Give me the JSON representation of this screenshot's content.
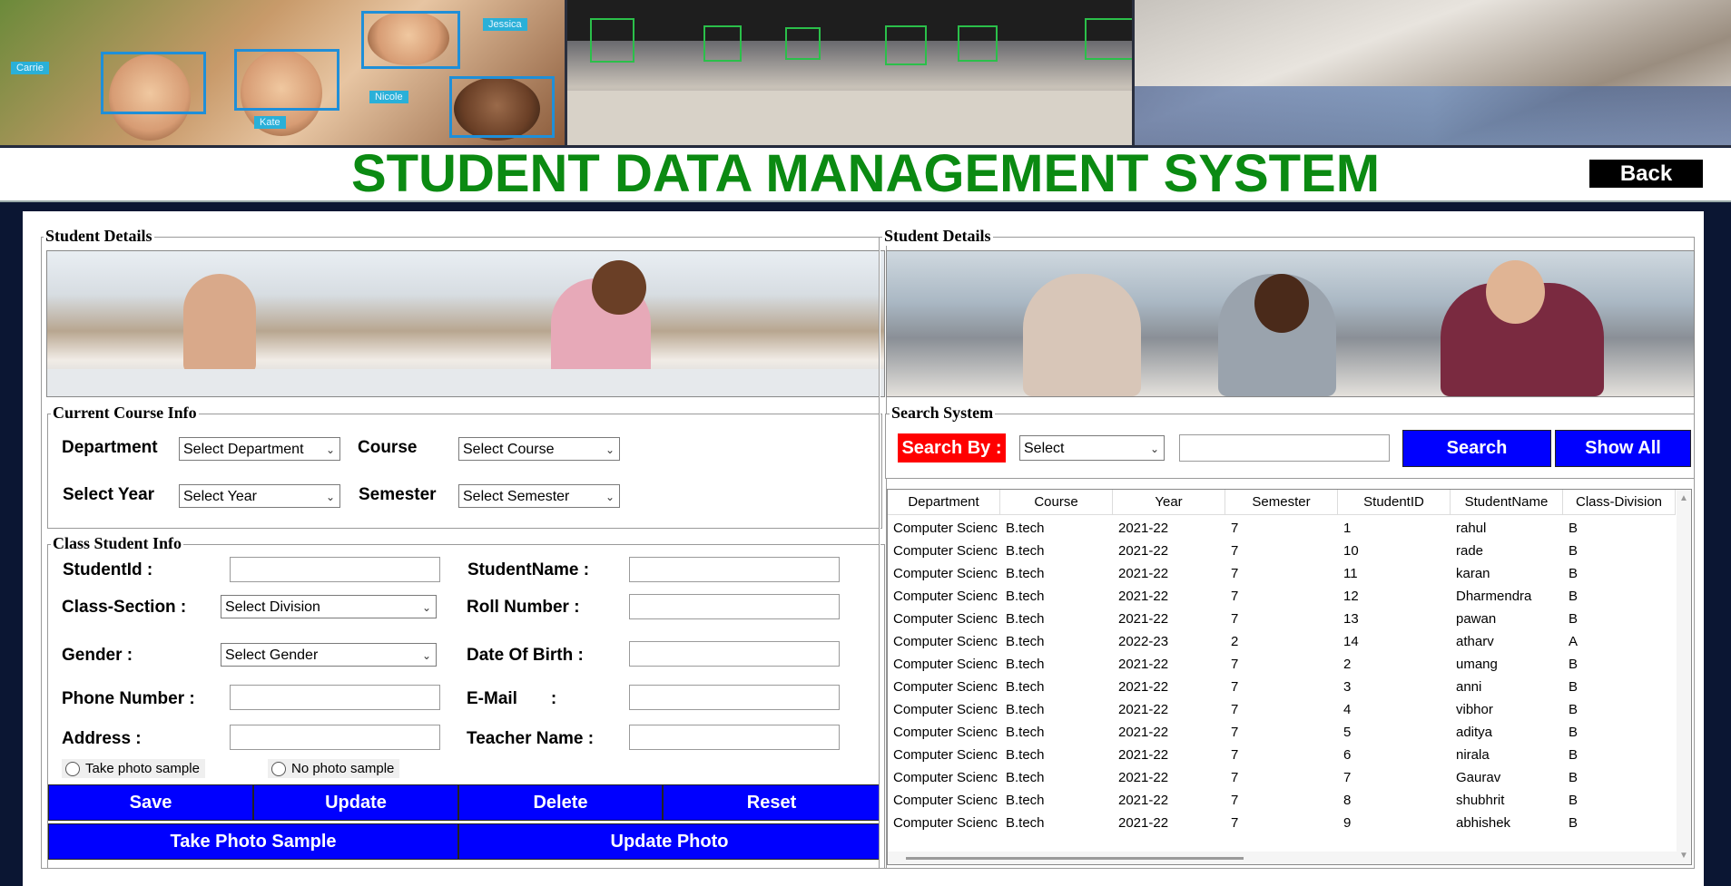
{
  "banner": {
    "name_tags": [
      "Carrie",
      "Kate",
      "Jessica",
      "Nicole"
    ]
  },
  "title": "STUDENT DATA MANAGEMENT SYSTEM",
  "back_label": "Back",
  "left_panel": {
    "legend": "Student Details",
    "course_info": {
      "legend": "Current Course Info",
      "department_label": "Department",
      "department_value": "Select Department",
      "course_label": "Course",
      "course_value": "Select Course",
      "year_label": "Select Year",
      "year_value": "Select Year",
      "semester_label": "Semester",
      "semester_value": "Select Semester"
    },
    "student_info": {
      "legend": "Class Student Info",
      "student_id_label": "StudentId :",
      "student_name_label": "StudentName :",
      "class_section_label": "Class-Section :",
      "class_section_value": "Select Division",
      "roll_number_label": "Roll Number :",
      "gender_label": "Gender :",
      "gender_value": "Select Gender",
      "dob_label": "Date Of Birth :",
      "phone_label": "Phone Number :",
      "email_label": "E-Mail       :",
      "address_label": "Address :",
      "teacher_label": "Teacher Name :",
      "radio_take": "Take photo sample",
      "radio_no": "No photo sample"
    },
    "buttons": {
      "save": "Save",
      "update": "Update",
      "delete": "Delete",
      "reset": "Reset",
      "take_photo": "Take Photo Sample",
      "update_photo": "Update Photo"
    }
  },
  "right_panel": {
    "legend": "Student Details",
    "search": {
      "legend": "Search System",
      "search_by_label": "Search By :",
      "search_by_value": "Select",
      "search_button": "Search",
      "show_all_button": "Show All"
    },
    "table": {
      "columns": [
        "Department",
        "Course",
        "Year",
        "Semester",
        "StudentID",
        "StudentName",
        "Class-Division"
      ],
      "rows": [
        [
          "Computer Scienc",
          "B.tech",
          "2021-22",
          "7",
          "1",
          "rahul",
          "B"
        ],
        [
          "Computer Scienc",
          "B.tech",
          "2021-22",
          "7",
          "10",
          "rade",
          "B"
        ],
        [
          "Computer Scienc",
          "B.tech",
          "2021-22",
          "7",
          "11",
          "karan",
          "B"
        ],
        [
          "Computer Scienc",
          "B.tech",
          "2021-22",
          "7",
          "12",
          "Dharmendra",
          "B"
        ],
        [
          "Computer Scienc",
          "B.tech",
          "2021-22",
          "7",
          "13",
          "pawan",
          "B"
        ],
        [
          "Computer Scienc",
          "B.tech",
          "2022-23",
          "2",
          "14",
          "atharv",
          "A"
        ],
        [
          "Computer Scienc",
          "B.tech",
          "2021-22",
          "7",
          "2",
          "umang",
          "B"
        ],
        [
          "Computer Scienc",
          "B.tech",
          "2021-22",
          "7",
          "3",
          "anni",
          "B"
        ],
        [
          "Computer Scienc",
          "B.tech",
          "2021-22",
          "7",
          "4",
          "vibhor",
          "B"
        ],
        [
          "Computer Scienc",
          "B.tech",
          "2021-22",
          "7",
          "5",
          "aditya",
          "B"
        ],
        [
          "Computer Scienc",
          "B.tech",
          "2021-22",
          "7",
          "6",
          "nirala",
          "B"
        ],
        [
          "Computer Scienc",
          "B.tech",
          "2021-22",
          "7",
          "7",
          "Gaurav",
          "B"
        ],
        [
          "Computer Scienc",
          "B.tech",
          "2021-22",
          "7",
          "8",
          "shubhrit",
          "B"
        ],
        [
          "Computer Scienc",
          "B.tech",
          "2021-22",
          "7",
          "9",
          "abhishek",
          "B"
        ]
      ]
    }
  },
  "colors": {
    "title_green": "#0b8a12",
    "button_blue": "#0000ff",
    "search_red": "#ff0000"
  }
}
